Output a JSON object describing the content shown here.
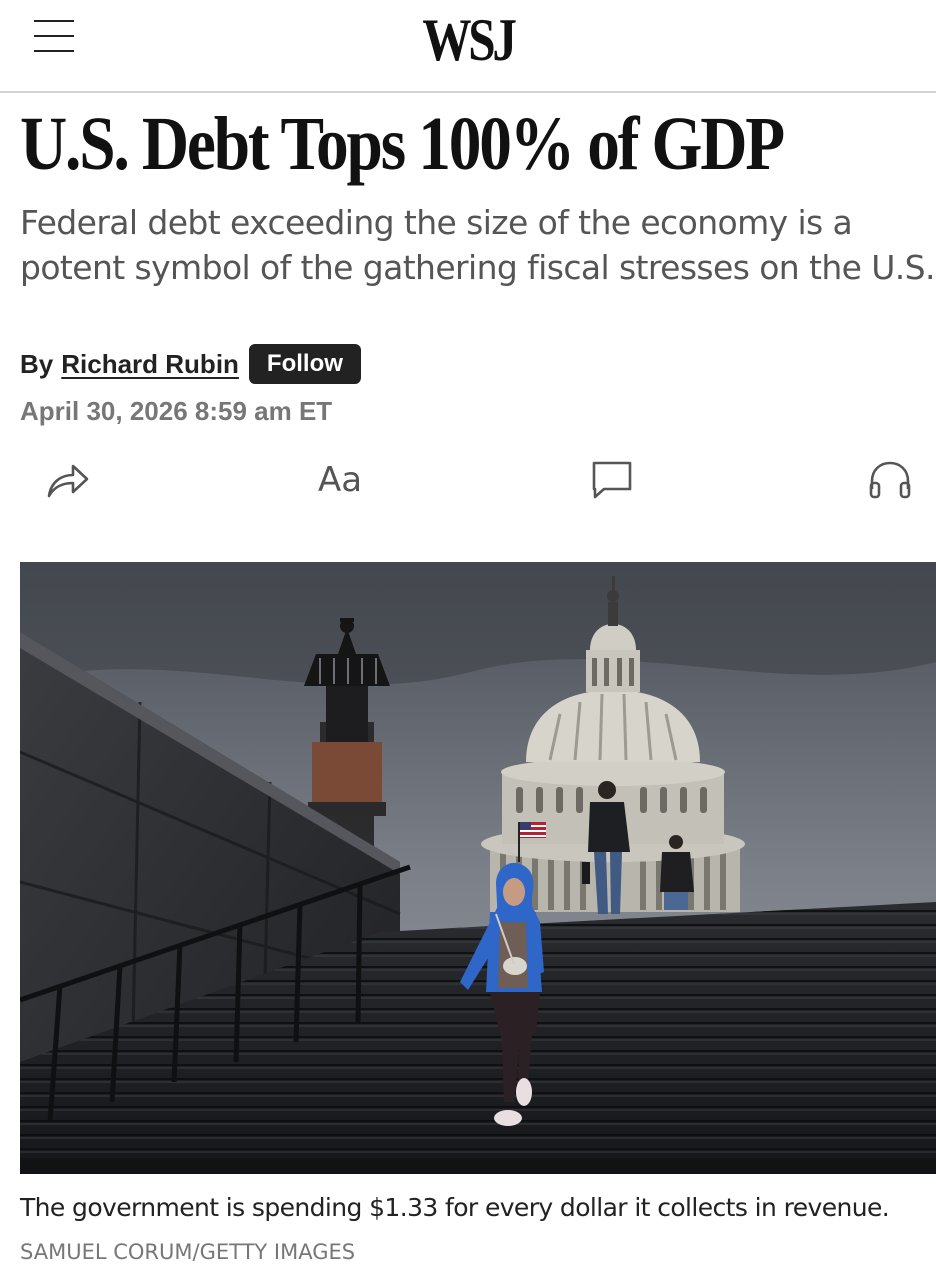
{
  "header": {
    "logo": "WSJ",
    "menu_icon": "hamburger-menu-icon"
  },
  "article": {
    "headline": "U.S. Debt Tops 100% of GDP",
    "dek": "Federal debt exceeding the size of the economy is a potent symbol of the gathering fiscal stresses on the U.S.",
    "byline_prefix": "By",
    "author": "Richard Rubin",
    "follow_label": "Follow",
    "date": "April 30, 2026 8:59 am ET"
  },
  "toolbar": {
    "share_icon": "share-icon",
    "text_size_label": "Aa",
    "comment_icon": "comment-icon",
    "listen_icon": "headphones-icon"
  },
  "photo": {
    "caption": "The government is spending $1.33 for every dollar it collects in revenue.",
    "credit": "SAMUEL CORUM/GETTY IMAGES"
  },
  "colors": {
    "text": "#111111",
    "dek": "#555555",
    "meta": "#777777",
    "button_bg": "#222222",
    "jacket_blue": "#2f67c9"
  }
}
